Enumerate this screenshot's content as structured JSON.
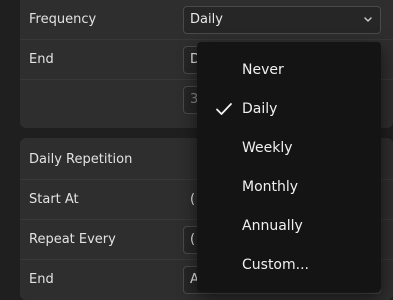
{
  "schedule": {
    "frequency_label": "Frequency",
    "frequency_value": "Daily",
    "end_label": "End",
    "end_value_partial": "D",
    "third_row_value_partial": "3"
  },
  "daily_repetition": {
    "section_title": "Daily Repetition",
    "start_at_label": "Start At",
    "start_at_value_partial": "(",
    "repeat_every_label": "Repeat Every",
    "repeat_every_value_partial": "(",
    "end_label": "End",
    "end_value_partial": "A"
  },
  "frequency_menu": {
    "selected": "Daily",
    "options": [
      "Never",
      "Daily",
      "Weekly",
      "Monthly",
      "Annually",
      "Custom..."
    ]
  },
  "icons": {
    "dropdown": "chevron-down-icon",
    "selected_option": "check-icon"
  },
  "colors": {
    "page_bg": "#1f1f1f",
    "card_bg": "#2e2e2e",
    "menu_bg": "#141414",
    "text": "#e6e6e6"
  }
}
